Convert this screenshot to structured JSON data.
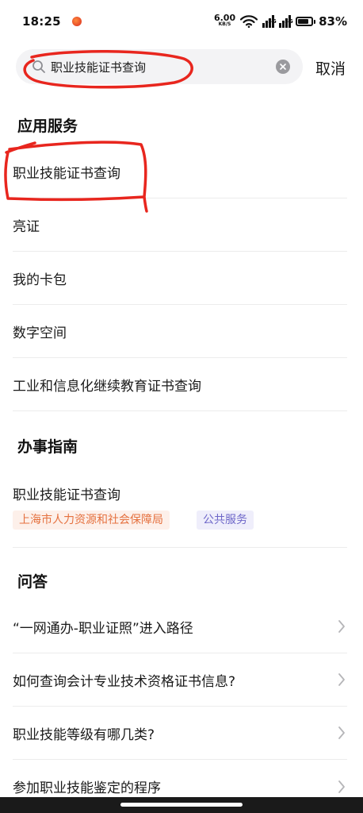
{
  "status_bar": {
    "time": "18:25",
    "net_speed_value": "6.00",
    "net_speed_unit": "KB/S",
    "signal1_label": "5G",
    "signal2_label": "5G",
    "battery_percent": "83%",
    "battery_level": 0.83
  },
  "search": {
    "query": "职业技能证书查询",
    "cancel_label": "取消"
  },
  "sections": {
    "app_services": {
      "title": "应用服务",
      "items": [
        {
          "label": "职业技能证书查询"
        },
        {
          "label": "亮证"
        },
        {
          "label": "我的卡包"
        },
        {
          "label": "数字空间"
        },
        {
          "label": "工业和信息化继续教育证书查询"
        }
      ]
    },
    "guide": {
      "title": "办事指南",
      "item": {
        "title": "职业技能证书查询",
        "org_tag": "上海市人力资源和社会保障局",
        "category_tag": "公共服务"
      }
    },
    "qa": {
      "title": "问答",
      "items": [
        {
          "label": "“一网通办-职业证照”进入路径"
        },
        {
          "label": "如何查询会计专业技术资格证书信息?"
        },
        {
          "label": "职业技能等级有哪几类?"
        },
        {
          "label": "参加职业技能鉴定的程序"
        }
      ]
    }
  },
  "colors": {
    "annotation": "#e8261e",
    "org_tag_text": "#e5713f",
    "category_tag_text": "#6e67c9"
  }
}
